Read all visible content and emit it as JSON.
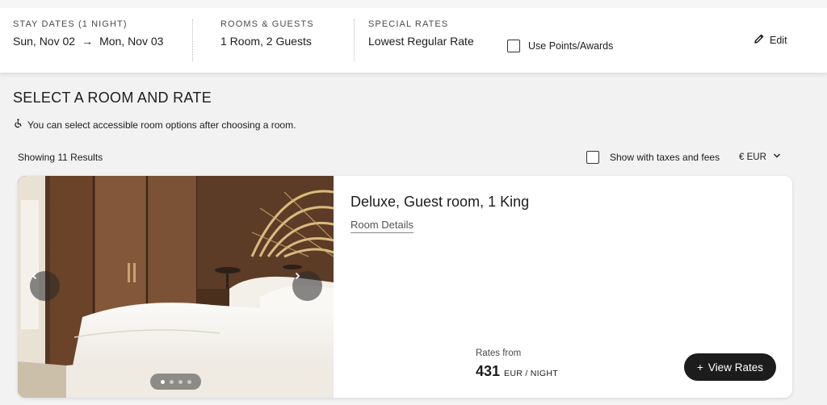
{
  "booking_bar": {
    "stay": {
      "label": "STAY DATES (1 NIGHT)",
      "check_in": "Sun, Nov 02",
      "arrow": "→",
      "check_out": "Mon, Nov 03"
    },
    "rooms": {
      "label": "ROOMS & GUESTS",
      "value": "1 Room, 2 Guests"
    },
    "rates": {
      "label": "SPECIAL RATES",
      "value": "Lowest Regular Rate"
    },
    "points": {
      "label": "Use Points/Awards",
      "checked": false
    },
    "edit_label": "Edit"
  },
  "page": {
    "title": "SELECT A ROOM AND RATE",
    "accessible_note": "You can select accessible room options after choosing a room.",
    "results_label": "Showing 11 Results",
    "taxes_label": "Show with taxes and fees",
    "currency_symbol": "€",
    "currency_code": "EUR"
  },
  "room_card": {
    "name": "Deluxe, Guest room, 1 King",
    "details_link": "Room Details",
    "rates_from_label": "Rates from",
    "price": "431",
    "price_unit": "EUR / NIGHT",
    "view_rates_label": "View Rates",
    "view_rates_icon": "+",
    "carousel": {
      "total_images": 4,
      "active_index": 0
    }
  },
  "colors": {
    "background": "#f2f2f2",
    "card": "#ffffff",
    "primary_button": "#1c1c1c",
    "text": "#1c1c1c"
  }
}
